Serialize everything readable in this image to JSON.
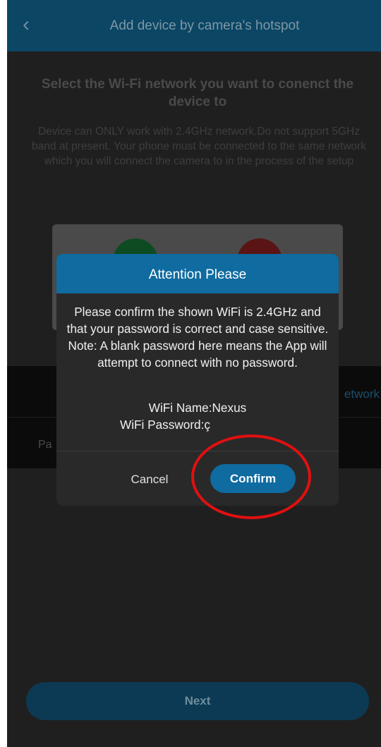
{
  "appbar": {
    "back_icon": "chevron-left-icon",
    "title": "Add device by camera's hotspot"
  },
  "main": {
    "heading": "Select the Wi-Fi network you want to conenct the device to",
    "description": "Device can ONLY work with 2.4GHz network.Do not support 5GHz band at present. Your phone must be connected to the same network which you will connect the camera to in the process of the setup",
    "network_link_partial": "etwork",
    "password_label_partial": "Pa"
  },
  "next_button": {
    "label": "Next"
  },
  "dialog": {
    "title": "Attention Please",
    "message": "Please confirm the shown WiFi is 2.4GHz and that your password is correct and case sensitive. Note: A blank password here means the App will attempt to connect with no password.",
    "wifi_name": "WiFi Name:Nexus",
    "wifi_password": "WiFi Password:ç",
    "cancel_label": "Cancel",
    "confirm_label": "Confirm"
  },
  "colors": {
    "appbar": "#0b4664",
    "dialog_accent": "#0f6ba0",
    "highlight": "#e01010"
  }
}
